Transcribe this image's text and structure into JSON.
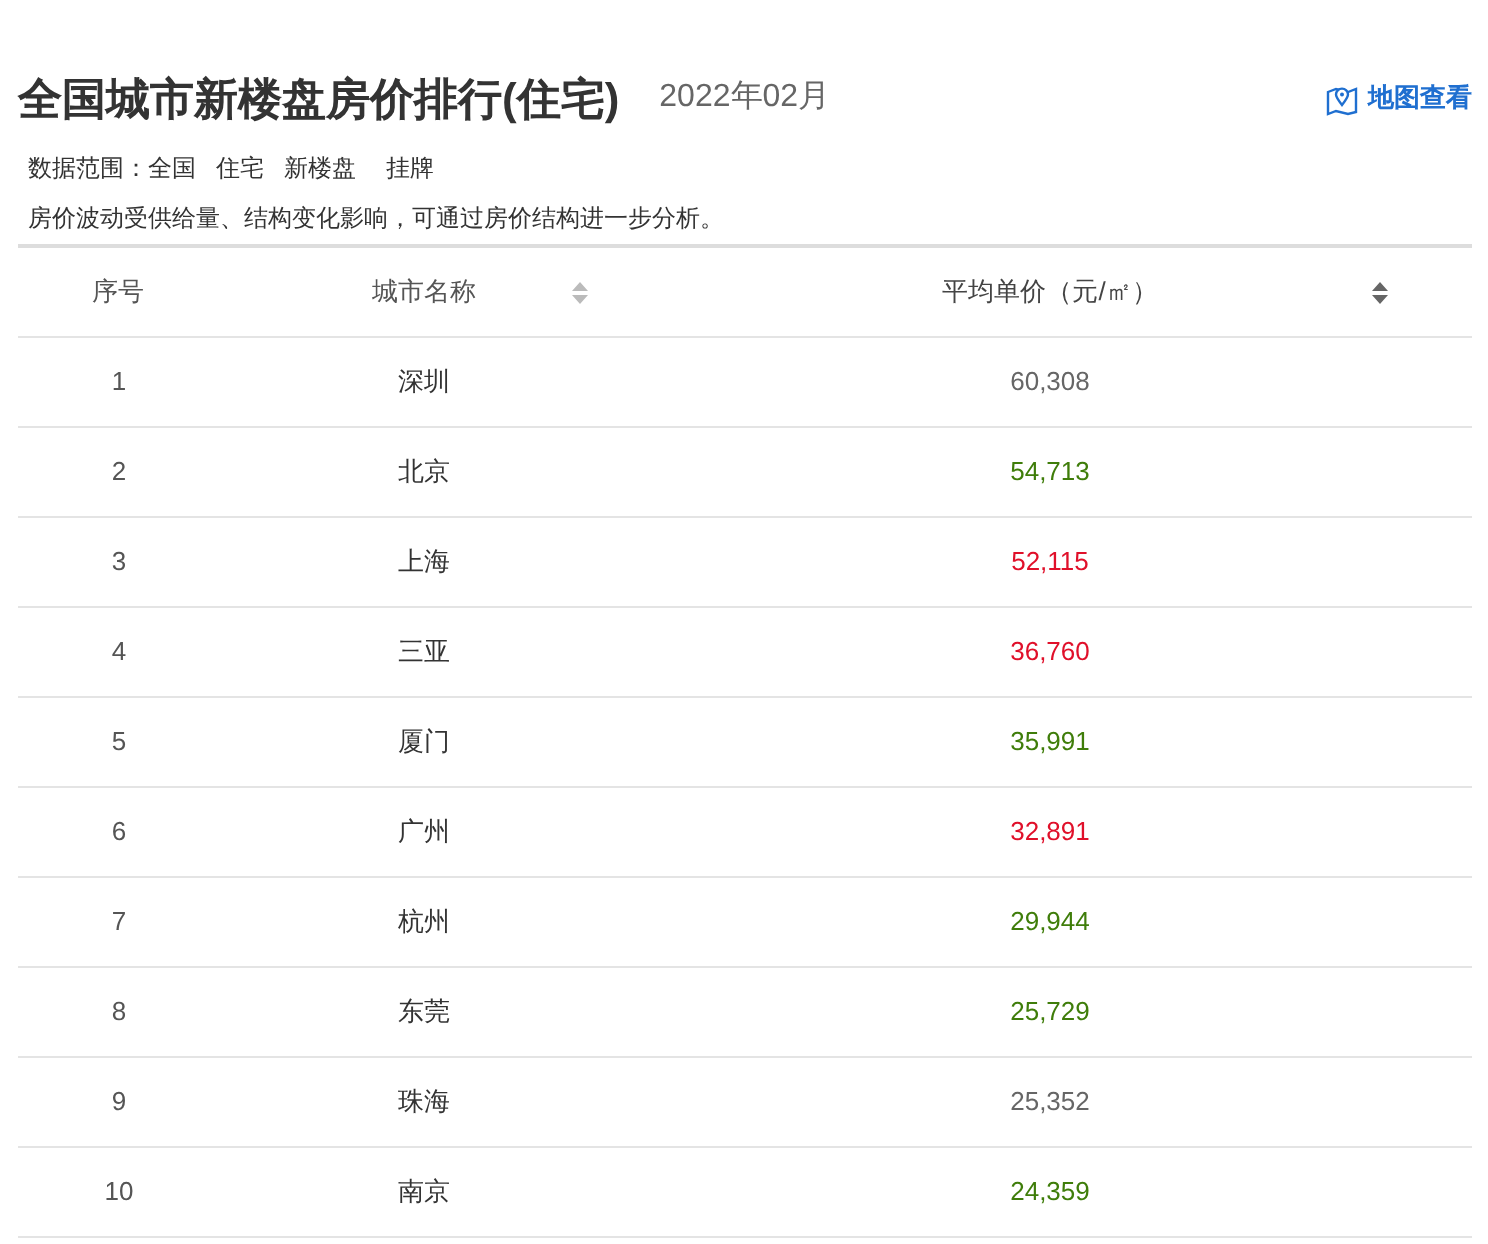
{
  "header": {
    "title": "全国城市新楼盘房价排行(住宅)",
    "period": "2022年02月",
    "map_link": "地图查看"
  },
  "scope": {
    "label": "数据范围：",
    "tags": [
      "全国",
      "住宅",
      "新楼盘",
      "挂牌"
    ]
  },
  "note": "房价波动受供给量、结构变化影响，可通过房价结构进一步分析。",
  "table": {
    "columns": [
      {
        "label": "序号",
        "sortable": false,
        "selected": false
      },
      {
        "label": "城市名称",
        "sortable": true,
        "selected": false
      },
      {
        "label": "平均单价（元/㎡）",
        "sortable": true,
        "selected": true
      }
    ],
    "rows": [
      {
        "rank": "1",
        "city": "深圳",
        "price": "60,308",
        "color": "#666666"
      },
      {
        "rank": "2",
        "city": "北京",
        "price": "54,713",
        "color": "#3f7d0a"
      },
      {
        "rank": "3",
        "city": "上海",
        "price": "52,115",
        "color": "#e0102a"
      },
      {
        "rank": "4",
        "city": "三亚",
        "price": "36,760",
        "color": "#e0102a"
      },
      {
        "rank": "5",
        "city": "厦门",
        "price": "35,991",
        "color": "#3f7d0a"
      },
      {
        "rank": "6",
        "city": "广州",
        "price": "32,891",
        "color": "#e0102a"
      },
      {
        "rank": "7",
        "city": "杭州",
        "price": "29,944",
        "color": "#3f7d0a"
      },
      {
        "rank": "8",
        "city": "东莞",
        "price": "25,729",
        "color": "#3f7d0a"
      },
      {
        "rank": "9",
        "city": "珠海",
        "price": "25,352",
        "color": "#666666"
      },
      {
        "rank": "10",
        "city": "南京",
        "price": "24,359",
        "color": "#3f7d0a"
      }
    ]
  }
}
